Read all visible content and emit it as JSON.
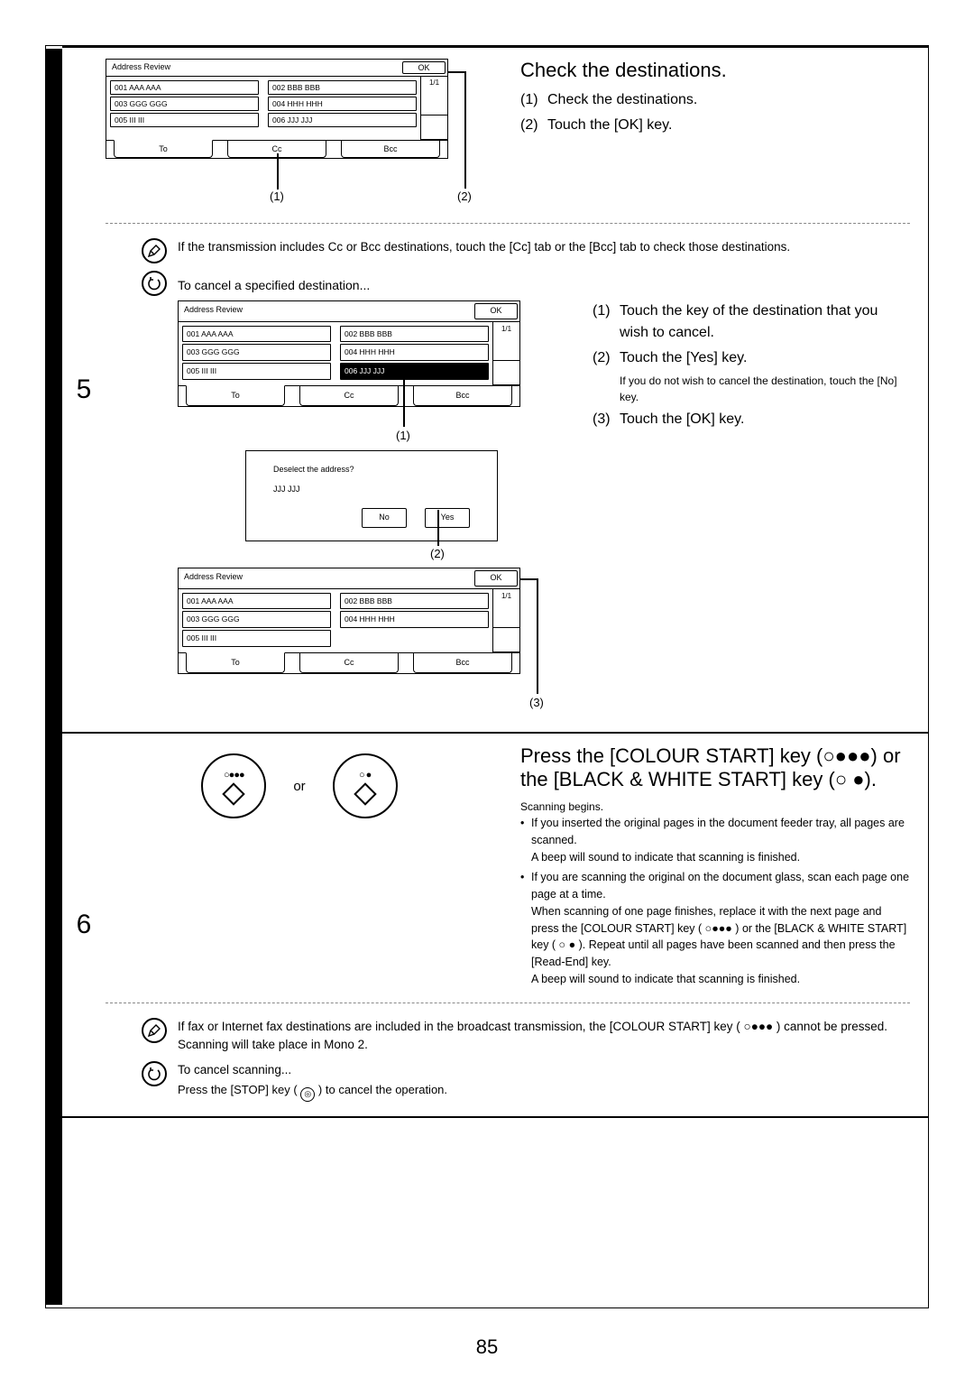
{
  "step5": {
    "number": "5",
    "title": "Check the destinations.",
    "instructions": [
      {
        "num": "(1)",
        "txt": "Check the destinations."
      },
      {
        "num": "(2)",
        "txt": "Touch the [OK] key."
      }
    ],
    "note1": "If the transmission includes Cc or Bcc destinations, touch the [Cc] tab or the [Bcc] tab to check those destinations.",
    "cancel_intro": "To cancel a specified destination...",
    "cancel_instructions": [
      {
        "num": "(1)",
        "txt": "Touch the key of the destination that you wish to cancel."
      },
      {
        "num": "(2)",
        "txt": "Touch the [Yes] key.",
        "sub": "If you do not wish to cancel the destination, touch the [No] key."
      },
      {
        "num": "(3)",
        "txt": "Touch the [OK] key."
      }
    ],
    "panel_title": "Address Review",
    "ok": "OK",
    "pager": "1/1",
    "entries": [
      "001  AAA AAA",
      "002  BBB BBB",
      "003  GGG GGG",
      "004  HHH HHH",
      "005  III III",
      "006  JJJ JJJ"
    ],
    "entries_after": [
      "001  AAA AAA",
      "002  BBB BBB",
      "003  GGG GGG",
      "004  HHH HHH",
      "005  III III"
    ],
    "tab_to": "To",
    "tab_cc": "Cc",
    "tab_bcc": "Bcc",
    "dialog_q": "Deselect the address?",
    "dialog_addr": "JJJ JJJ",
    "no": "No",
    "yes": "Yes",
    "callout1": "(1)",
    "callout2": "(2)",
    "callout3": "(3)"
  },
  "step6": {
    "number": "6",
    "or": "or",
    "title_a": "Press the [COLOUR START] key (",
    "title_b": ") or the [BLACK & WHITE START] key (",
    "title_c": ").",
    "colour_dots": "○●●●",
    "bw_dots": "○ ●",
    "scan_begins": "Scanning begins.",
    "bullets": [
      "If you inserted the original pages in the document feeder tray, all pages are scanned.\nA beep will sound to indicate that scanning is finished.",
      "If you are scanning the original on the document glass, scan each page one page at a time.\nWhen scanning of one page finishes, replace it with the next page and press the [COLOUR START] key ( ○●●● ) or the [BLACK & WHITE START] key ( ○ ● ). Repeat until all pages have been scanned and then press the [Read-End] key.\nA beep will sound to indicate that scanning is finished."
    ],
    "note2_a": "If fax or Internet fax destinations are included in the broadcast transmission, the [COLOUR START] key ( ",
    "note2_b": " ) cannot be pressed. Scanning will take place in Mono 2.",
    "cancel_scan_title": "To cancel scanning...",
    "cancel_scan_body_a": "Press the [STOP] key ( ",
    "cancel_scan_body_b": " ) to cancel the operation.",
    "stop_glyph": "◎"
  },
  "page_number": "85"
}
